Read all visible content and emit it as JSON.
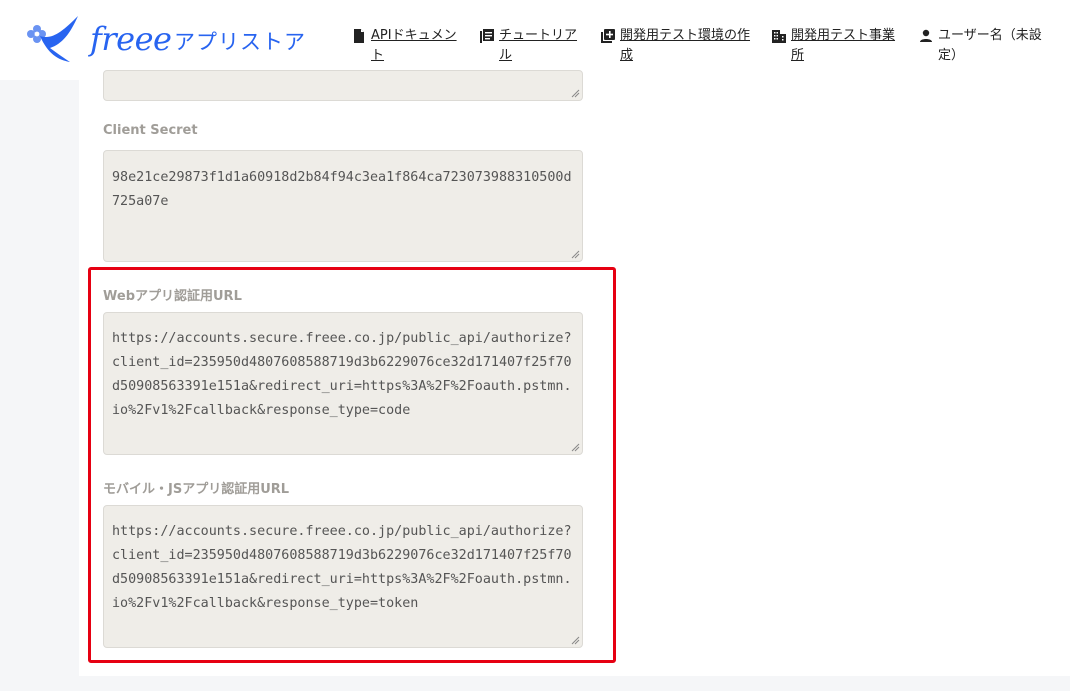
{
  "header": {
    "logo_word": "freee",
    "logo_store": "アプリストア",
    "nav": [
      {
        "label": "APIドキュメント",
        "icon": "document-icon"
      },
      {
        "label": "チュートリアル",
        "icon": "book-icon"
      },
      {
        "label": "開発用テスト環境の作成",
        "icon": "add-box-icon"
      },
      {
        "label": "開発用テスト事業所",
        "icon": "building-icon"
      },
      {
        "label": "ユーザー名（未設定）",
        "icon": "user-icon"
      }
    ]
  },
  "fields": {
    "client_secret": {
      "label": "Client Secret",
      "value": "98e21ce29873f1d1a60918d2b84f94c3ea1f864ca723073988310500d725a07e"
    },
    "web_auth_url": {
      "label": "Webアプリ認証用URL",
      "value": "https://accounts.secure.freee.co.jp/public_api/authorize?client_id=235950d4807608588719d3b6229076ce32d171407f25f70d50908563391e151a&redirect_uri=https%3A%2F%2Foauth.pstmn.io%2Fv1%2Fcallback&response_type=code"
    },
    "mobile_auth_url": {
      "label": "モバイル・JSアプリ認証用URL",
      "value": "https://accounts.secure.freee.co.jp/public_api/authorize?client_id=235950d4807608588719d3b6229076ce32d171407f25f70d50908563391e151a&redirect_uri=https%3A%2F%2Foauth.pstmn.io%2Fv1%2Fcallback&response_type=token"
    }
  },
  "colors": {
    "brand": "#2864f0",
    "highlight": "#e60012",
    "textarea_bg": "#efede8"
  }
}
